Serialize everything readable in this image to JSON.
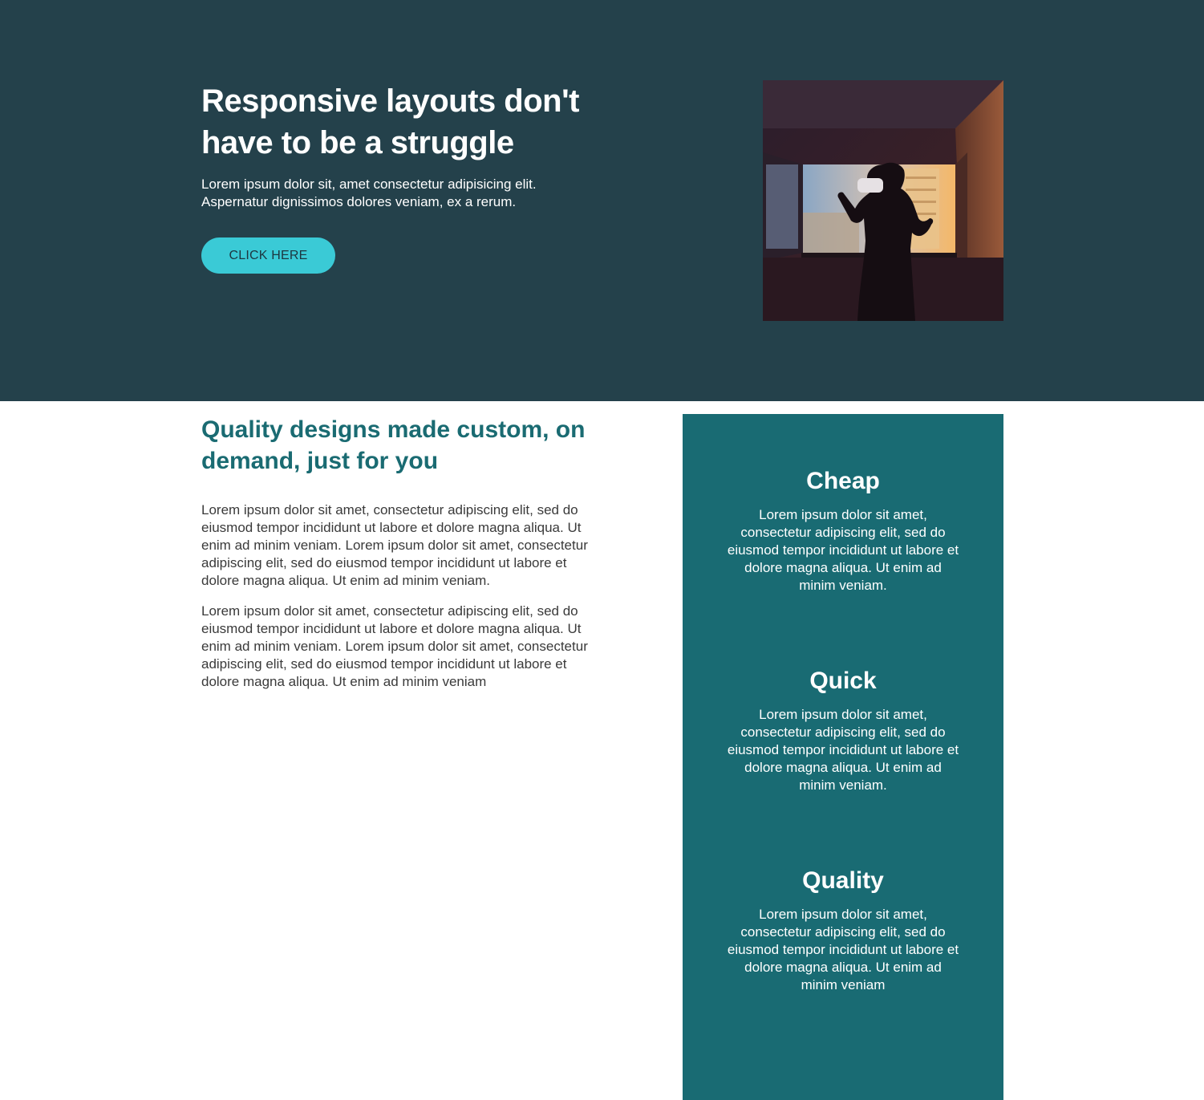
{
  "hero": {
    "title": "Responsive layouts don't have to be a struggle",
    "subtitle": "Lorem ipsum dolor sit, amet consectetur adipisicing elit. Aspernatur dignissimos dolores veniam, ex a rerum.",
    "button_label": "CLICK HERE",
    "image_alt": "Person wearing VR headset silhouetted against a window at sunset"
  },
  "content": {
    "title": "Quality designs made custom, on demand, just for you",
    "paragraphs": [
      "Lorem ipsum dolor sit amet, consectetur adipiscing elit, sed do eiusmod tempor incididunt ut labore et dolore magna aliqua. Ut enim ad minim veniam. Lorem ipsum dolor sit amet, consectetur adipiscing elit, sed do eiusmod tempor incididunt ut labore et dolore magna aliqua. Ut enim ad minim veniam.",
      "Lorem ipsum dolor sit amet, consectetur adipiscing elit, sed do eiusmod tempor incididunt ut labore et dolore magna aliqua. Ut enim ad minim veniam. Lorem ipsum dolor sit amet, consectetur adipiscing elit, sed do eiusmod tempor incididunt ut labore et dolore magna aliqua. Ut enim ad minim veniam"
    ]
  },
  "features": [
    {
      "title": "Cheap",
      "text": "Lorem ipsum dolor sit amet, consectetur adipiscing elit, sed do eiusmod tempor incididunt ut labore et dolore magna aliqua. Ut enim ad minim veniam."
    },
    {
      "title": "Quick",
      "text": "Lorem ipsum dolor sit amet, consectetur adipiscing elit, sed do eiusmod tempor incididunt ut labore et dolore magna aliqua. Ut enim ad minim veniam."
    },
    {
      "title": "Quality",
      "text": "Lorem ipsum dolor sit amet, consectetur adipiscing elit, sed do eiusmod tempor incididunt ut labore et dolore magna aliqua. Ut enim ad minim veniam"
    }
  ],
  "colors": {
    "hero_bg": "#24414b",
    "accent": "#3acad6",
    "heading_teal": "#1a6b72",
    "features_bg": "#196b73"
  }
}
